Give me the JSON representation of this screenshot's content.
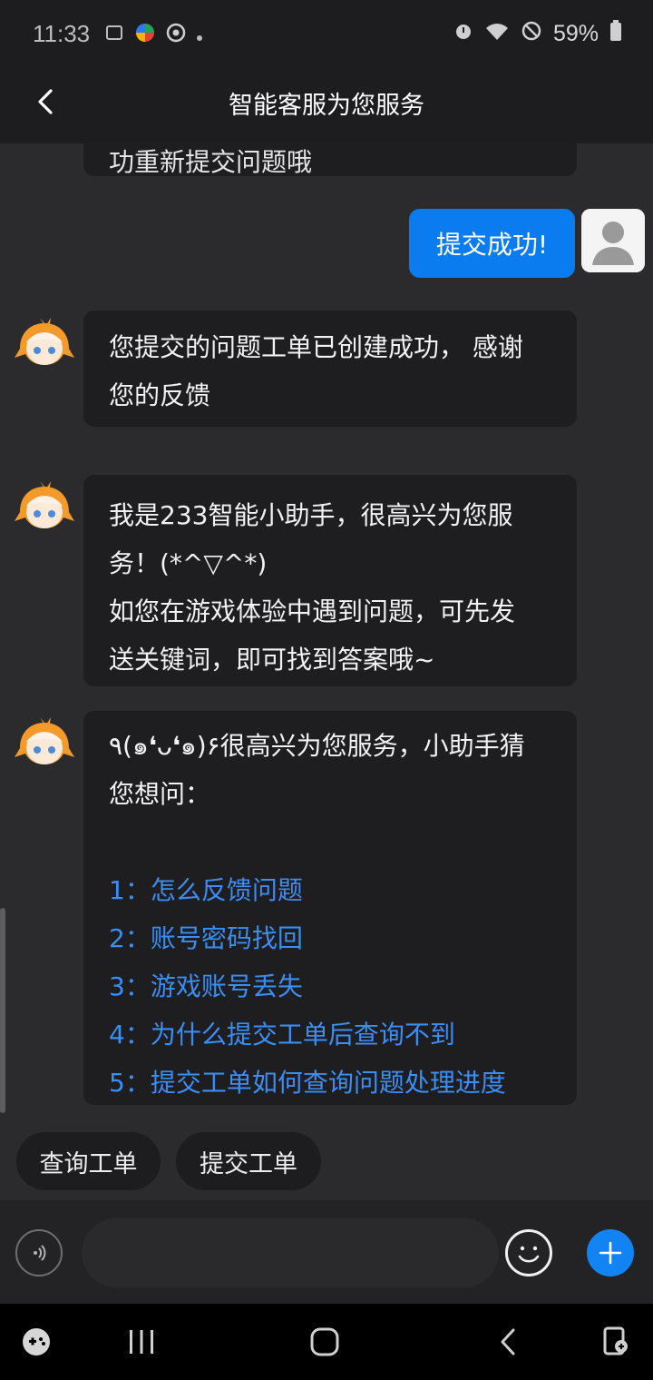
{
  "status_bar": {
    "time": "11:33",
    "battery": "59%",
    "left_icons": [
      "sim-icon",
      "app-icon",
      "app2-icon",
      "dot-icon"
    ],
    "right_icons": [
      "alarm-icon",
      "wifi-icon",
      "dnd-icon",
      "battery-icon"
    ]
  },
  "header": {
    "title": "智能客服为您服务",
    "back_icon": "back-arrow-icon"
  },
  "chat": {
    "cut_message": "功重新提交问题哦",
    "user_message": "提交成功!",
    "bot_message_1": [
      "您提交的问题工单已创建成功， 感谢",
      "您的反馈"
    ],
    "bot_message_2": [
      "我是233智能小助手，很高兴为您服",
      "务！(*^▽^*)",
      "如您在游戏体验中遇到问题，可先发",
      "送关键词，即可找到答案哦~"
    ],
    "bot_message_3": {
      "intro": [
        "٩(๑❛ᴗ❛๑)۶很高兴为您服务，小助手猜",
        "您想问："
      ],
      "links": [
        "1：怎么反馈问题",
        "2：账号密码找回",
        "3：游戏账号丢失",
        "4：为什么提交工单后查询不到",
        "5：提交工单如何查询问题处理进度"
      ]
    }
  },
  "quick_replies": [
    "查询工单",
    "提交工单"
  ],
  "input_bar": {
    "placeholder": "",
    "icons": [
      "voice-icon",
      "emoji-icon",
      "plus-icon"
    ]
  },
  "nav_bar": {
    "icons": [
      "game-launcher-icon",
      "recents-icon",
      "home-icon",
      "back-icon",
      "screenshot-icon"
    ]
  },
  "colors": {
    "accent": "#0a7cf0",
    "link": "#3a8ef5",
    "background": "#2b2b2d",
    "bubble": "#1e1e20"
  }
}
